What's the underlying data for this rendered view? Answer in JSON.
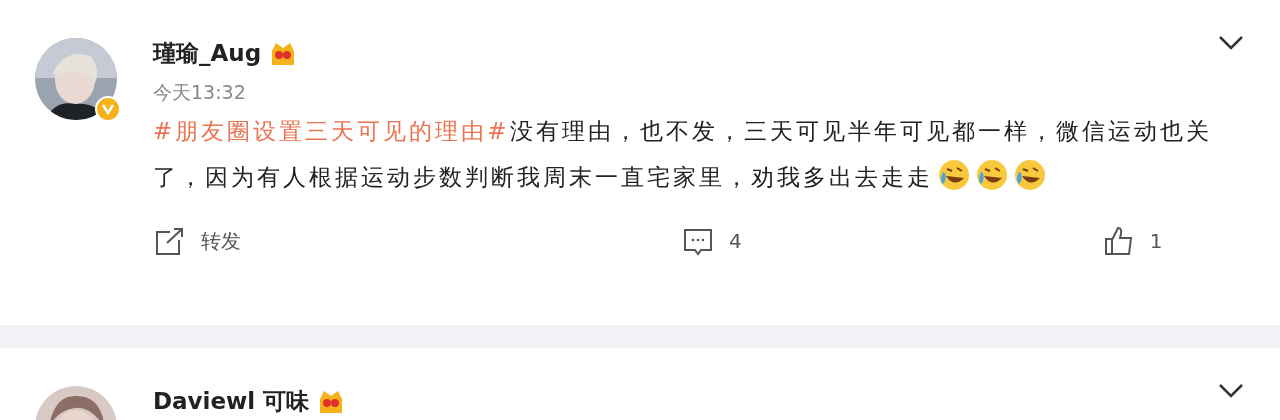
{
  "posts": [
    {
      "author": "瑾瑜_Aug",
      "verified": true,
      "time": "今天13:32",
      "text": [
        {
          "kind": "hashtag",
          "text": "#朋友圈设置三天可见的理由#"
        },
        {
          "kind": "plain",
          "text": "没有理由，也不发，三天可见半年可见都一样，微信运动也关了，因为有人根据运动步数判断我周末一直宅家里，劝我多出去走走"
        },
        {
          "kind": "emoji"
        },
        {
          "kind": "emoji"
        },
        {
          "kind": "emoji"
        }
      ],
      "actions": [
        {
          "kind": "repost",
          "label": "转发"
        },
        {
          "kind": "comment",
          "label": "4"
        },
        {
          "kind": "like",
          "label": "1"
        }
      ]
    },
    {
      "author": "Daviewl 可味"
    }
  ]
}
